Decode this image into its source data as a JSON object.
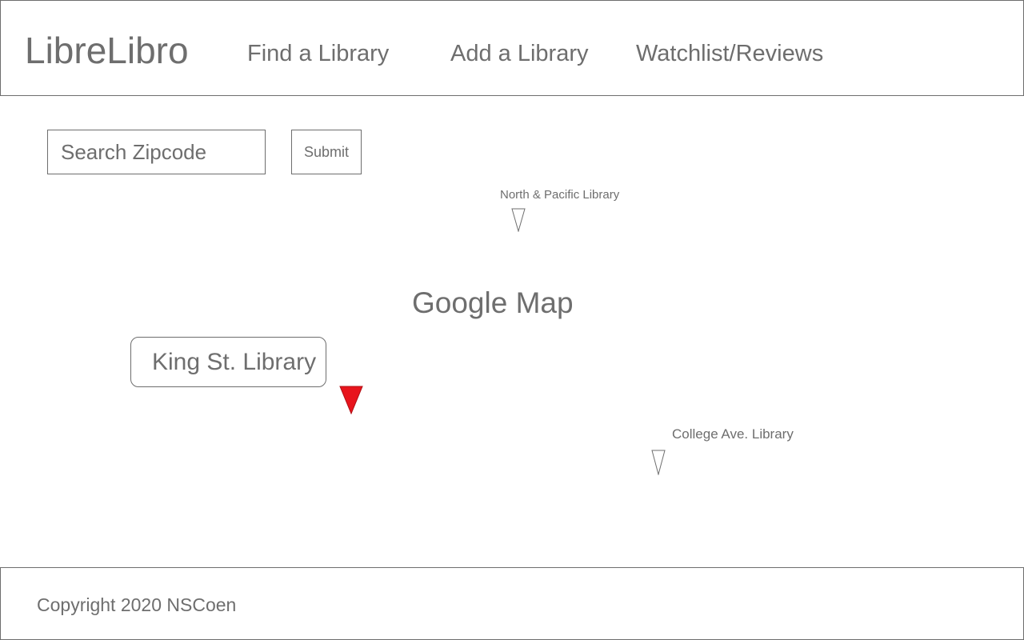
{
  "header": {
    "logo": "LibreLibro",
    "nav": [
      {
        "label": "Find a Library"
      },
      {
        "label": "Add a Library"
      },
      {
        "label": "Watchlist/Reviews"
      }
    ]
  },
  "search": {
    "placeholder": "Search Zipcode",
    "value": "",
    "submit_label": "Submit"
  },
  "map": {
    "label": "Google Map",
    "markers": [
      {
        "name": "North & Pacific Library",
        "selected": false,
        "color": "#ffffff"
      },
      {
        "name": "King St. Library",
        "selected": true,
        "color": "#e8141c"
      },
      {
        "name": "College Ave. Library",
        "selected": false,
        "color": "#ffffff"
      }
    ],
    "popup": {
      "title": "King St. Library"
    }
  },
  "footer": {
    "copyright": "Copyright 2020 NSCoen"
  },
  "colors": {
    "text": "#6e6e6e",
    "border": "#6e6e6e",
    "selected_marker": "#e8141c",
    "background": "#ffffff"
  }
}
